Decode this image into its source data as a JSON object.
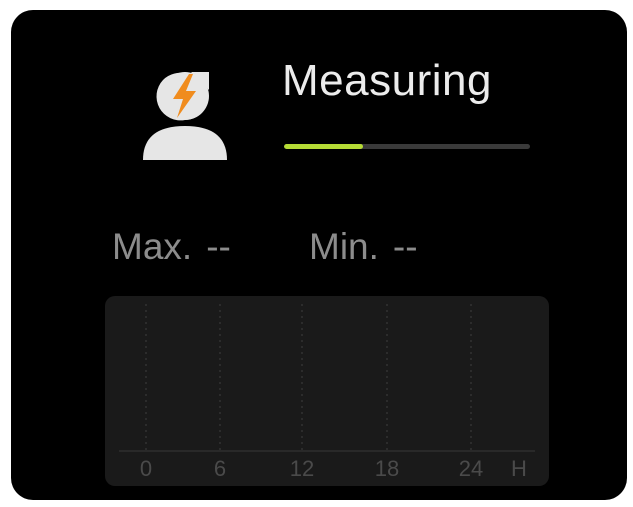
{
  "status": {
    "title": "Measuring",
    "progress": 0.32,
    "progress_color": "#b6dc35",
    "track_color": "#3a3a3a"
  },
  "avatar": {
    "icon": "person-lightning-icon",
    "bolt_color": "#f08c1e",
    "body_color": "#e6e6e6"
  },
  "stats": {
    "max_label": "Max.",
    "max_value": "--",
    "min_label": "Min.",
    "min_value": "--"
  },
  "chart_data": {
    "type": "line",
    "x_ticks": [
      "0",
      "6",
      "12",
      "18",
      "24"
    ],
    "x_unit": "H",
    "series": [],
    "grid": true
  }
}
